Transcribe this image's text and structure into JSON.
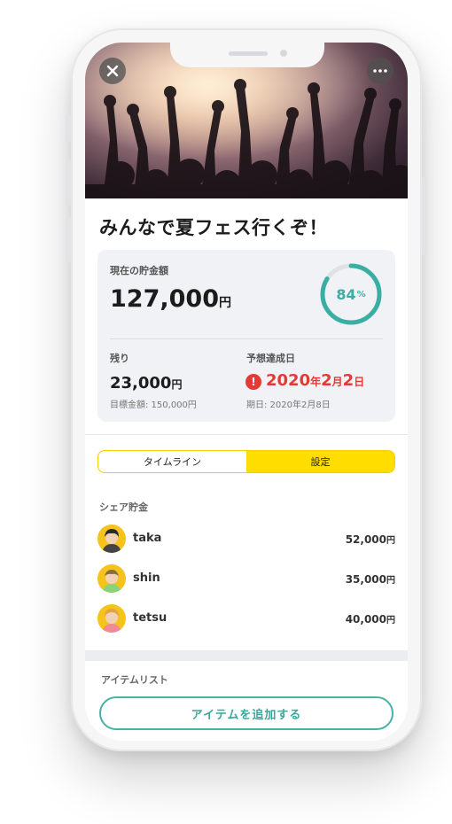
{
  "header": {
    "close_icon": "close-icon",
    "menu_icon": "more-horizontal-icon"
  },
  "goal": {
    "title": "みんなで夏フェス行くぞ！"
  },
  "summary": {
    "current_label": "現在の貯金額",
    "current_amount": "127,000",
    "current_unit": "円",
    "progress_percent": 84,
    "progress_number": "84",
    "progress_unit": "%",
    "remaining_label": "残り",
    "remaining_amount": "23,000",
    "remaining_unit": "円",
    "target_text": "目標金額: 150,000円",
    "forecast_label": "予想達成日",
    "forecast_year": "2020",
    "forecast_year_unit": "年",
    "forecast_month": "2",
    "forecast_month_unit": "月",
    "forecast_day": "2",
    "forecast_day_unit": "日",
    "deadline_text": "期日: 2020年2月8日",
    "warn_symbol": "!"
  },
  "tabs": [
    {
      "label": "タイムライン",
      "active": false
    },
    {
      "label": "設定",
      "active": true
    }
  ],
  "share": {
    "label": "シェア貯金",
    "members": [
      {
        "name": "taka",
        "amount": "52,000",
        "unit": "円"
      },
      {
        "name": "shin",
        "amount": "35,000",
        "unit": "円"
      },
      {
        "name": "tetsu",
        "amount": "40,000",
        "unit": "円"
      }
    ]
  },
  "items": {
    "label": "アイテムリスト",
    "add_button": "アイテムを追加する"
  },
  "colors": {
    "accent": "#3aaea3",
    "tab_active": "#ffdd00",
    "warning": "#e53935",
    "avatar_bg": "#f5c31c"
  }
}
